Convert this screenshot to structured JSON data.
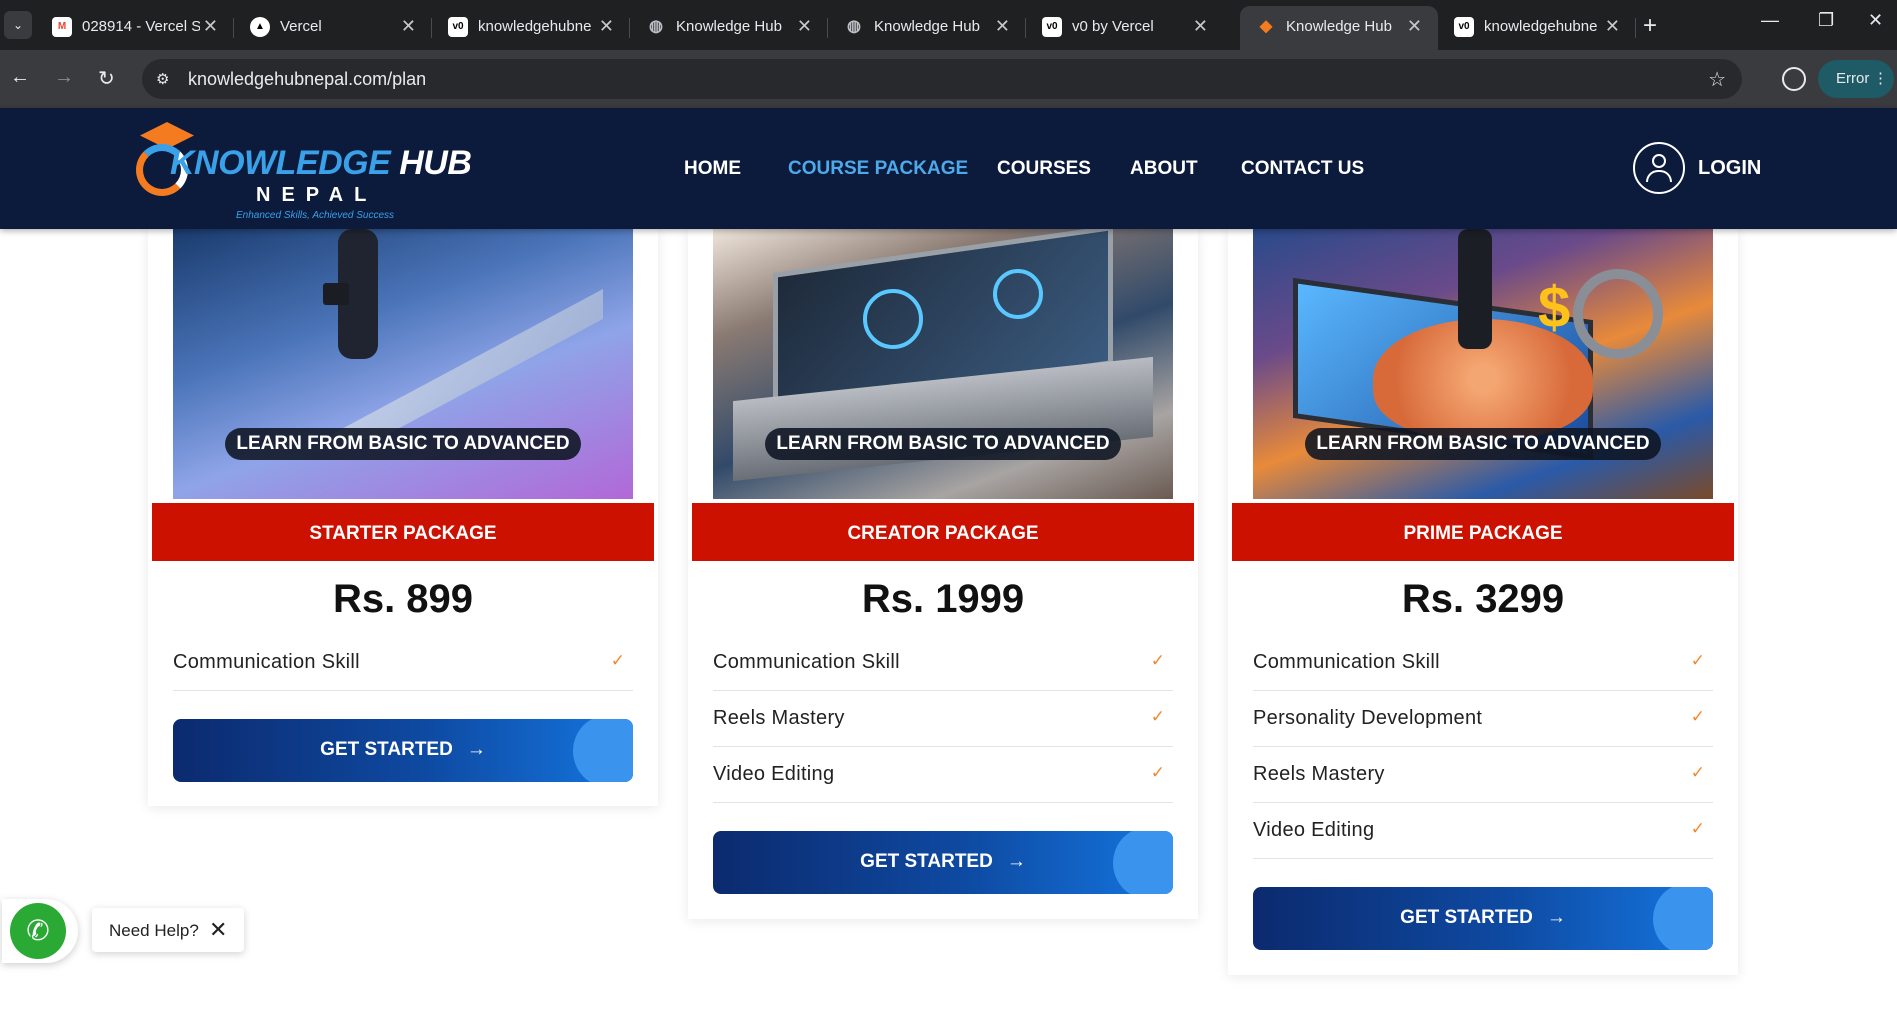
{
  "browser": {
    "tabs": [
      {
        "title": "028914 - Vercel S",
        "favicon": "gmail-icon",
        "favicon_color": "#ea4335",
        "favicon_text": "M",
        "active": false
      },
      {
        "title": "Vercel",
        "favicon": "vercel-icon",
        "favicon_color": "#000000",
        "favicon_text": "▲",
        "active": false
      },
      {
        "title": "knowledgehubne",
        "favicon": "v0-icon",
        "favicon_color": "#ffffff",
        "favicon_text": "v0",
        "active": false
      },
      {
        "title": "Knowledge Hub",
        "favicon": "globe-icon",
        "favicon_color": "#5f6368",
        "favicon_text": "◍",
        "active": false
      },
      {
        "title": "Knowledge Hub",
        "favicon": "globe-icon",
        "favicon_color": "#5f6368",
        "favicon_text": "◍",
        "active": false
      },
      {
        "title": "v0 by Vercel",
        "favicon": "v0-icon",
        "favicon_color": "#ffffff",
        "favicon_text": "v0",
        "active": false
      },
      {
        "title": "Knowledge Hub",
        "favicon": "knowledge-hub-icon",
        "favicon_color": "#f47b20",
        "favicon_text": "◆",
        "active": true
      },
      {
        "title": "knowledgehubne",
        "favicon": "v0-icon",
        "favicon_color": "#ffffff",
        "favicon_text": "v0",
        "active": false
      }
    ],
    "url": "knowledgehubnepal.com/plan",
    "error_label": "Error"
  },
  "site": {
    "logo": {
      "word1": "KNOWLEDGE",
      "word2": "HUB",
      "sub": "NEPAL",
      "tagline": "Enhanced Skills, Achieved Success"
    },
    "nav": [
      "HOME",
      "COURSE PACKAGE",
      "COURSES",
      "ABOUT",
      "CONTACT US"
    ],
    "active_nav": "COURSE PACKAGE",
    "login_label": "LOGIN",
    "colors": {
      "header_bg": "#0c1a3c",
      "accent_blue": "#4ea9ea",
      "package_red": "#cc1100",
      "check_orange": "#f08a2e"
    }
  },
  "packages": [
    {
      "banner": "LEARN FROM BASIC TO ADVANCED",
      "name": "STARTER PACKAGE",
      "price": "Rs. 899",
      "features": [
        "Communication Skill"
      ],
      "cta": "GET STARTED"
    },
    {
      "banner": "LEARN FROM BASIC TO ADVANCED",
      "name": "CREATOR PACKAGE",
      "price": "Rs. 1999",
      "features": [
        "Communication Skill",
        "Reels Mastery",
        "Video Editing"
      ],
      "cta": "GET STARTED"
    },
    {
      "banner": "LEARN FROM BASIC TO ADVANCED",
      "name": "PRIME PACKAGE",
      "price": "Rs. 3299",
      "features": [
        "Communication Skill",
        "Personality Development",
        "Reels Mastery",
        "Video Editing"
      ],
      "cta": "GET STARTED"
    }
  ],
  "help_widget": {
    "label": "Need Help?"
  }
}
